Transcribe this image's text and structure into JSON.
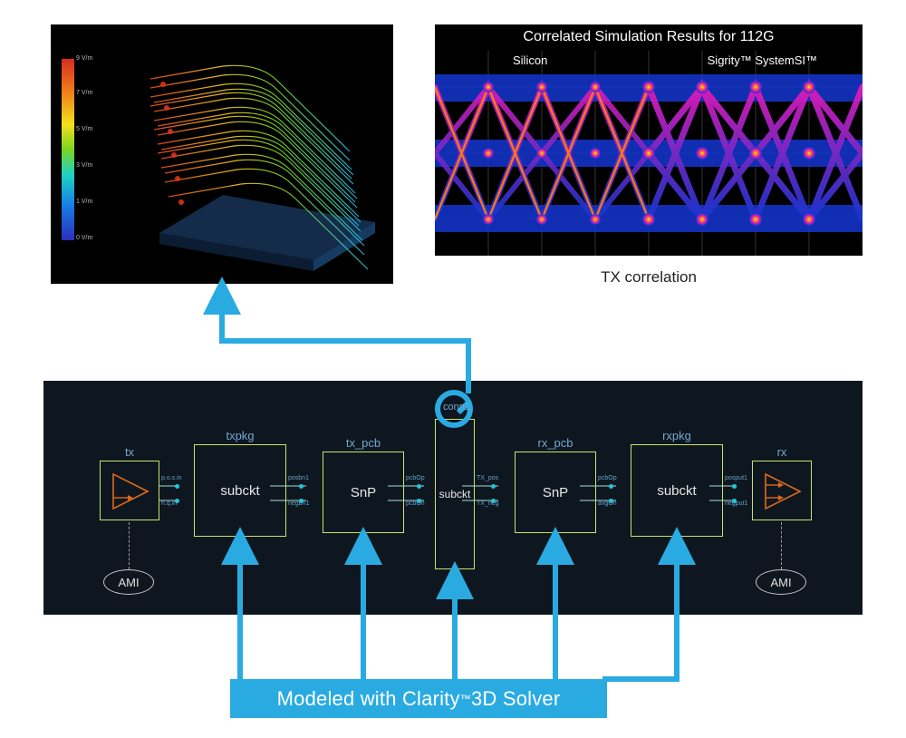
{
  "panels": {
    "em3d": {
      "colorbar_labels": [
        "9 V/m",
        "7 V/m",
        "5 V/m",
        "3 V/m",
        "1 V/m",
        "0 V/m"
      ]
    },
    "eye": {
      "title": "Correlated Simulation Results for 112G",
      "left_label": "Silicon",
      "right_label": "Sigrity™ SystemSI™",
      "caption": "TX correlation"
    }
  },
  "chain": {
    "blocks": [
      {
        "id": "tx",
        "label": "tx",
        "content": "",
        "type": "amp"
      },
      {
        "id": "txpkg",
        "label": "txpkg",
        "content": "subckt",
        "type": "sub"
      },
      {
        "id": "txpcb",
        "label": "tx_pcb",
        "content": "SnP",
        "type": "snp"
      },
      {
        "id": "conn1",
        "label": "conn1",
        "content": "subckt",
        "type": "sub"
      },
      {
        "id": "rxpcb",
        "label": "rx_pcb",
        "content": "SnP",
        "type": "snp"
      },
      {
        "id": "rxpkg",
        "label": "rxpkg",
        "content": "subckt",
        "type": "sub"
      },
      {
        "id": "rx",
        "label": "rx",
        "content": "",
        "type": "amp"
      }
    ],
    "port_labels": {
      "tx_r": [
        "p.o.s.in",
        "h.q.in"
      ],
      "txpkg_l": [
        "posbn1",
        "negbn1"
      ],
      "txpkg_r": [
        "posbn1",
        "negbn1"
      ],
      "txpcb_r": [
        "pcbOp",
        "pcbOn"
      ],
      "conn1_r": [
        "TX_pos",
        "TX_neg"
      ],
      "rxpcb_r": [
        "pcbOp",
        "avgOn"
      ],
      "rxpkg_r": [
        "posput1",
        "negput1"
      ]
    },
    "ami_label": "AMI"
  },
  "banner": {
    "text_prefix": "Modeled with Clarity",
    "text_suffix": " 3D Solver",
    "tm": "™"
  },
  "colors": {
    "accent": "#29abe2",
    "dark_panel": "#0e1720",
    "block_border": "#c7e36d"
  }
}
